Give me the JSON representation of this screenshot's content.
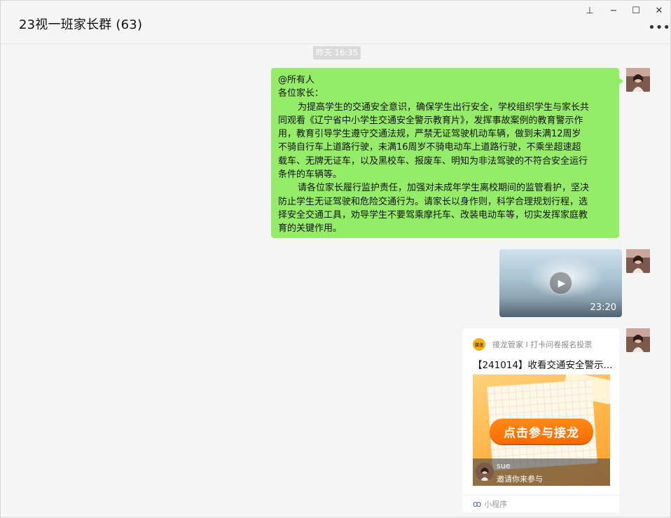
{
  "header": {
    "title": "23视一班家长群 (63)",
    "pin_glyph": "⊥",
    "minimize_glyph": "−",
    "maximize_glyph": "☐",
    "close_glyph": "✕",
    "more_glyph": "•••"
  },
  "timestamp": "昨天 16:35",
  "messages": {
    "text": {
      "lines": [
        "@所有人",
        "各位家长：",
        "为提高学生的交通安全意识，确保学生出行安全，学校组织学生与家长共",
        "同观看《辽宁省中小学生交通安全警示教育片》，发挥事故案例的教育警示作",
        "用，教育引导学生遵守交通法规，严禁无证驾驶机动车辆，做到未满12周岁",
        "不骑自行车上道路行驶，未满16周岁不骑电动车上道路行驶，不乘坐超速超",
        "载车、无牌无证车，以及黑校车、报废车、明知为非法驾驶的不符合安全运行",
        "条件的车辆等。",
        "请各位家长履行监护责任，加强对未成年学生离校期间的监管看护，坚决",
        "防止学生无证驾驶和危险交通行为。请家长以身作则，科学合理规划行程，选",
        "择安全交通工具，劝导学生不要驾乘摩托车、改装电动车等，切实发挥家庭教",
        "育的关键作用。"
      ]
    },
    "video": {
      "duration": "23:20",
      "play_glyph": "▶"
    },
    "mini_program": {
      "logo_text": "接龙",
      "source_name": "接龙管家 I 打卡问卷报名投票",
      "title": "【241014】收看交通安全警示...",
      "cta": "点击参与接龙",
      "inviter": "sue",
      "invite_text": "邀请你来参与",
      "footer_icon": "ꝏ",
      "footer_label": "小程序"
    }
  },
  "colors": {
    "bubble_green": "#95ec69",
    "background": "#f5f5f5",
    "cta_orange": "#f76b00",
    "link_blue": "#576b95"
  }
}
